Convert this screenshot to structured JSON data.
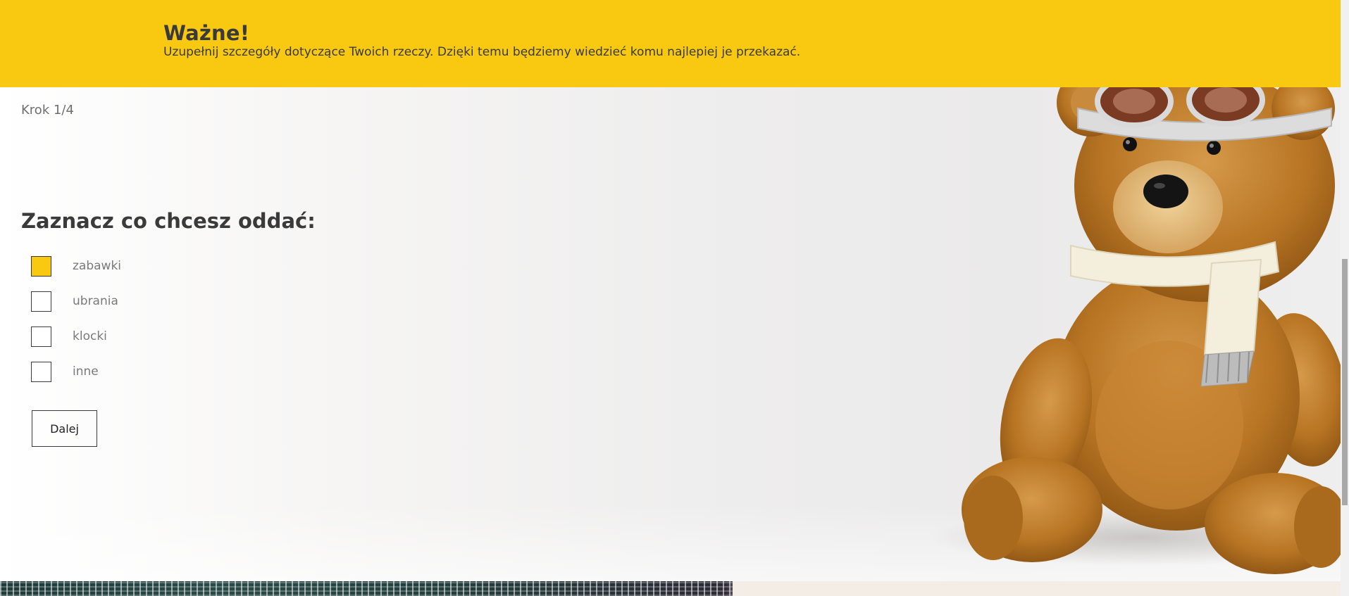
{
  "banner": {
    "title": "Ważne!",
    "text": "Uzupełnij szczegóły dotyczące Twoich rzeczy. Dzięki temu będziemy wiedzieć komu najlepiej je przekazać."
  },
  "form": {
    "step": "Krok 1/4",
    "title": "Zaznacz co chcesz oddać:",
    "options": [
      {
        "label": "zabawki",
        "checked": true
      },
      {
        "label": "ubrania",
        "checked": false
      },
      {
        "label": "klocki",
        "checked": false
      },
      {
        "label": "inne",
        "checked": false
      }
    ],
    "next_label": "Dalej"
  },
  "icons": {
    "illustration": "teddy-bear-image",
    "checked_color": "#f8c910"
  },
  "colors": {
    "accent": "#f8c910",
    "text_dark": "#3a3a3a",
    "text_muted": "#7a7a7a"
  }
}
